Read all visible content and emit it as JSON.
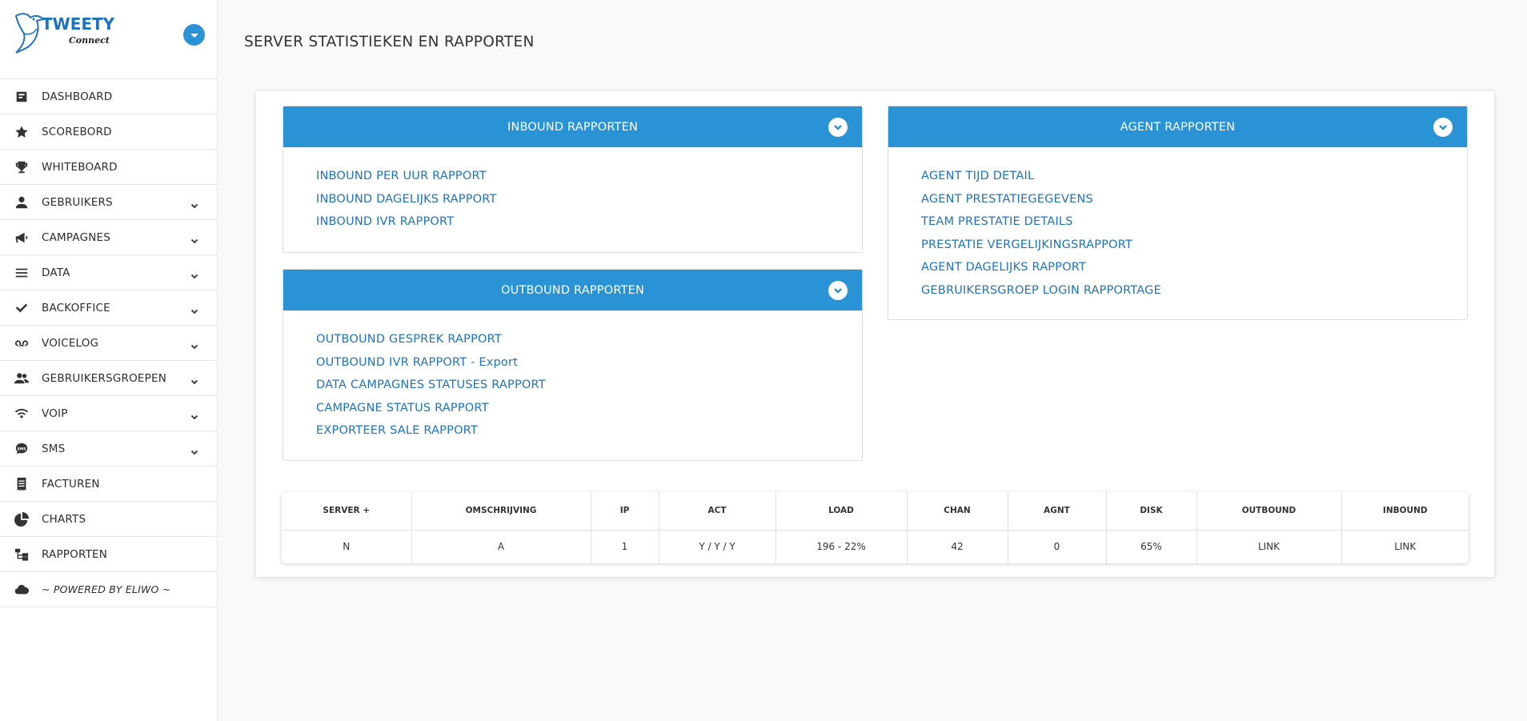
{
  "brand": {
    "name": "TWEETY",
    "sub": "Connect"
  },
  "sidebar": {
    "items": [
      {
        "label": "DASHBOARD",
        "icon": "dashboard-icon",
        "chevron": false
      },
      {
        "label": "SCOREBORD",
        "icon": "star-icon",
        "chevron": false
      },
      {
        "label": "WHITEBOARD",
        "icon": "trophy-icon",
        "chevron": false
      },
      {
        "label": "GEBRUIKERS",
        "icon": "user-icon",
        "chevron": true
      },
      {
        "label": "CAMPAGNES",
        "icon": "megaphone-icon",
        "chevron": true
      },
      {
        "label": "DATA",
        "icon": "list-icon",
        "chevron": true
      },
      {
        "label": "BACKOFFICE",
        "icon": "check-icon",
        "chevron": true
      },
      {
        "label": "VOICELOG",
        "icon": "voicemail-icon",
        "chevron": true
      },
      {
        "label": "GEBRUIKERSGROEPEN",
        "icon": "users-icon",
        "chevron": true
      },
      {
        "label": "VOIP",
        "icon": "wifi-icon",
        "chevron": true
      },
      {
        "label": "SMS",
        "icon": "sms-icon",
        "chevron": true
      },
      {
        "label": "FACTUREN",
        "icon": "receipt-icon",
        "chevron": false
      },
      {
        "label": "CHARTS",
        "icon": "pie-chart-icon",
        "chevron": false
      },
      {
        "label": "RAPPORTEN",
        "icon": "hierarchy-icon",
        "chevron": false
      },
      {
        "label": "~ POWERED BY ELIWO ~",
        "icon": "cloud-icon",
        "chevron": false
      }
    ]
  },
  "page": {
    "title": "SERVER STATISTIEKEN EN RAPPORTEN"
  },
  "inbound": {
    "title": "INBOUND RAPPORTEN",
    "links": [
      "INBOUND PER UUR RAPPORT",
      "INBOUND DAGELIJKS RAPPORT",
      "INBOUND IVR RAPPORT"
    ]
  },
  "outbound": {
    "title": "OUTBOUND RAPPORTEN",
    "links": [
      "OUTBOUND GESPREK RAPPORT",
      "OUTBOUND IVR RAPPORT - Export",
      "DATA CAMPAGNES STATUSES RAPPORT",
      "CAMPAGNE STATUS RAPPORT",
      "EXPORTEER SALE RAPPORT"
    ]
  },
  "agent": {
    "title": "AGENT RAPPORTEN",
    "links": [
      "AGENT TIJD DETAIL",
      "AGENT PRESTATIEGEGEVENS",
      "TEAM PRESTATIE DETAILS",
      "PRESTATIE VERGELIJKINGSRAPPORT",
      "AGENT DAGELIJKS RAPPORT",
      "GEBRUIKERSGROEP LOGIN RAPPORTAGE"
    ]
  },
  "table": {
    "headers": [
      "SERVER +",
      "OMSCHRIJVING",
      "IP",
      "ACT",
      "LOAD",
      "CHAN",
      "AGNT",
      "DISK",
      "OUTBOUND",
      "INBOUND"
    ],
    "rows": [
      [
        "N",
        "A",
        "1",
        "Y / Y / Y",
        "196 - 22%",
        "42",
        "0",
        "65%",
        "LINK",
        "LINK"
      ]
    ]
  },
  "colors": {
    "accent": "#2a93d5",
    "link": "#1e73be"
  }
}
